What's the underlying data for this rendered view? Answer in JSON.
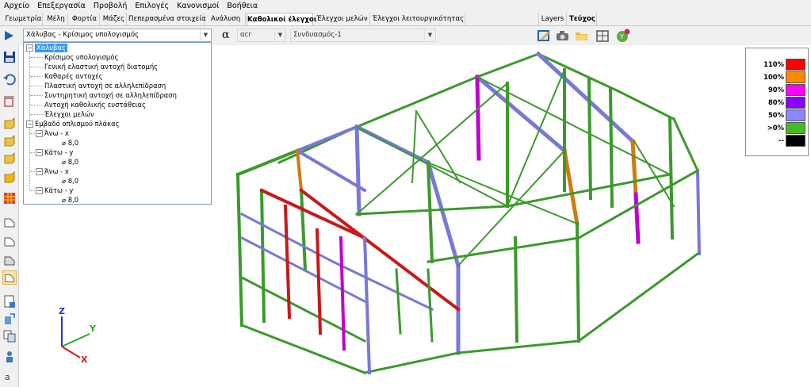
{
  "menu": {
    "items": [
      "Αρχείο",
      "Επεξεργασία",
      "Προβολή",
      "Επιλογές",
      "Κανονισμοί",
      "Βοήθεια"
    ]
  },
  "tabs": {
    "items": [
      "Γεωμετρία",
      "Μέλη",
      "Φορτία",
      "Μάζες",
      "Πεπερασμένα στοιχεία",
      "Ανάλυση",
      "Καθολικοί έλεγχοι",
      "Έλεγχοι μελών",
      "Έλεγχοι λειτουργικότητας"
    ],
    "active": "Καθολικοί έλεγχοι",
    "right": [
      "Layers",
      "Τεύχος"
    ]
  },
  "toolbar": {
    "check_select": "Χάλυβας - Κρίσιμος υπολογισμός",
    "alpha_symbol": "α",
    "alpha_select": "αcr",
    "combination_select": "Συνδυασμός-1"
  },
  "tree": {
    "root": "Χάλυβας",
    "children": [
      "Κρίσιμος υπολογισμός",
      "Γενική ελαστική αντοχή διατομής",
      "Καθαρές αντοχές",
      "Πλαστική αντοχή σε αλληλεπίδραση",
      "Συντηρητική αντοχή σε αλληλεπίδραση",
      "Αντοχή καθολικής ευστάθειας",
      "Έλεγχοι μελών"
    ],
    "slab": "Εμβαδό οπλισμού πλάκας",
    "slab_items": [
      {
        "label": "Άνω - x",
        "value": "⌀ 8,0"
      },
      {
        "label": "Κάτω - y",
        "value": "⌀ 8,0"
      },
      {
        "label": "Άνω - x",
        "value": "⌀ 8,0"
      },
      {
        "label": "Κάτω - y",
        "value": "⌀ 8,0"
      }
    ]
  },
  "legend": {
    "rows": [
      {
        "label": "110%",
        "color": "#ff0000"
      },
      {
        "label": "100%",
        "color": "#ff8800"
      },
      {
        "label": "90%",
        "color": "#ff00ff"
      },
      {
        "label": "80%",
        "color": "#8800ff"
      },
      {
        "label": "50%",
        "color": "#8888ff"
      },
      {
        "label": ">0%",
        "color": "#44bb22"
      },
      {
        "label": "--",
        "color": "#000000"
      }
    ]
  },
  "axes": {
    "x": "X",
    "y": "Y",
    "z": "Z"
  },
  "colors": {
    "accent": "#3399ff",
    "member_green": "#3a9a2a",
    "member_blue": "#7878d8",
    "member_red": "#c81818",
    "member_purple": "#c000d0",
    "member_orange": "#d07a10"
  }
}
